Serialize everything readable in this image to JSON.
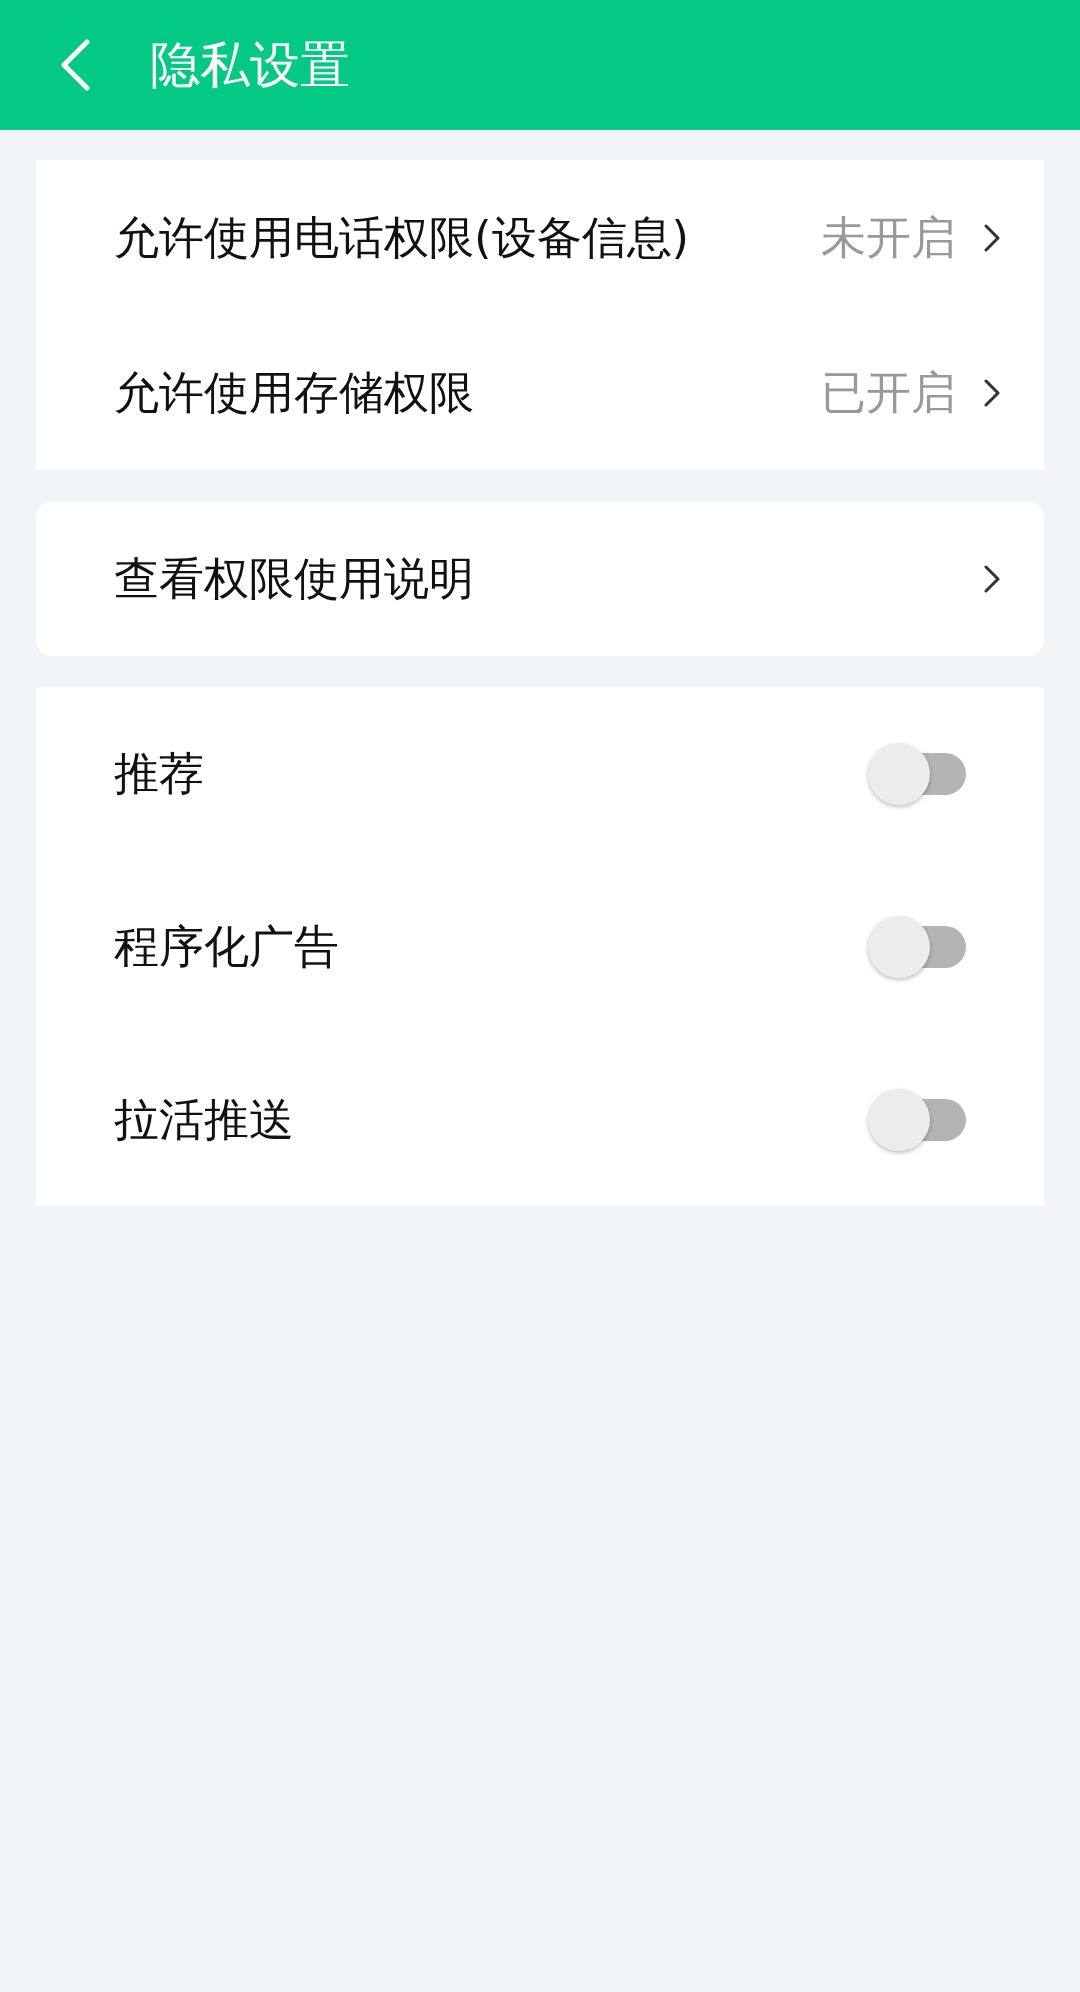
{
  "header": {
    "title": "隐私设置"
  },
  "groups": [
    {
      "items": [
        {
          "kind": "link",
          "label": "允许使用电话权限(设备信息)",
          "value": "未开启"
        },
        {
          "kind": "link",
          "label": "允许使用存储权限",
          "value": "已开启"
        }
      ]
    },
    {
      "items": [
        {
          "kind": "link",
          "label": "查看权限使用说明"
        }
      ]
    },
    {
      "items": [
        {
          "kind": "toggle",
          "label": "推荐",
          "on": false
        },
        {
          "kind": "toggle",
          "label": "程序化广告",
          "on": false
        },
        {
          "kind": "toggle",
          "label": "拉活推送",
          "on": false
        }
      ]
    }
  ]
}
